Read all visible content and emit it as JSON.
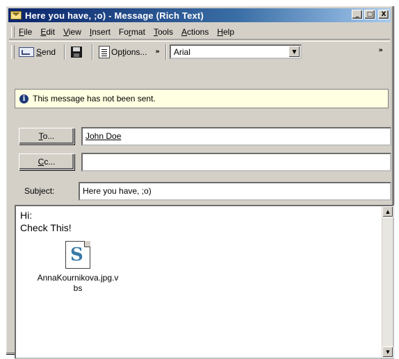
{
  "window": {
    "title": "Here you have, ;o) - Message (Rich Text)",
    "controls": {
      "minimize": "_",
      "maximize": "□",
      "close": "X"
    }
  },
  "menu": [
    {
      "label": "File",
      "key": "F",
      "rest": "ile"
    },
    {
      "label": "Edit",
      "key": "E",
      "rest": "dit"
    },
    {
      "label": "View",
      "key": "V",
      "rest": "iew"
    },
    {
      "label": "Insert",
      "key": "I",
      "rest": "nsert"
    },
    {
      "label": "Format",
      "pre": "Fo",
      "key": "r",
      "rest": "mat"
    },
    {
      "label": "Tools",
      "key": "T",
      "rest": "ools"
    },
    {
      "label": "Actions",
      "key": "A",
      "rest": "ctions"
    },
    {
      "label": "Help",
      "key": "H",
      "rest": "elp"
    }
  ],
  "toolbar": {
    "send_key": "S",
    "send_rest": "end",
    "options_pre": "Op",
    "options_key": "t",
    "options_rest": "ions...",
    "font": "Arial",
    "more": "»"
  },
  "info": {
    "icon": "i",
    "message": "This message has not been sent."
  },
  "header": {
    "to_button": {
      "key": "T",
      "rest": "o..."
    },
    "to_value": "John Doe",
    "cc_button": {
      "key": "C",
      "rest": "c..."
    },
    "cc_value": "",
    "subject_label": "Subject:",
    "subject_value": "Here you have, ;o)"
  },
  "body": {
    "line1": "Hi:",
    "line2": "Check This!",
    "attachment_name_line1": "AnnaKournikova.jpg.v",
    "attachment_name_line2": "bs",
    "attachment_icon": "script-file-icon",
    "attachment_glyph": "S"
  },
  "scroll": {
    "up": "▲",
    "down": "▼"
  }
}
